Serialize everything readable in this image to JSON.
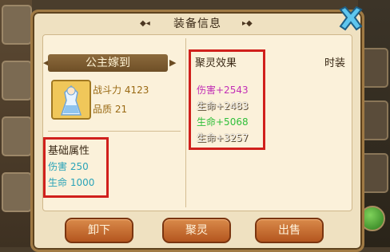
{
  "window": {
    "title": "装备信息"
  },
  "item": {
    "name": "公主嫁到",
    "combat_label": "战斗力",
    "combat_value": "4123",
    "quality_label": "品质",
    "quality_value": "21"
  },
  "base_attrs": {
    "title": "基础属性",
    "items": [
      {
        "label": "伤害",
        "value": "250"
      },
      {
        "label": "生命",
        "value": "1000"
      }
    ]
  },
  "spirit": {
    "title": "聚灵效果",
    "items": [
      {
        "text": "伤害+2543",
        "color": "#c22fb6"
      },
      {
        "text": "生命+2483",
        "color": "#ffffff"
      },
      {
        "text": "生命+5068",
        "color": "#2fbf3a"
      },
      {
        "text": "生命+3257",
        "color": "#ffffff"
      }
    ]
  },
  "fashion": {
    "title": "时装"
  },
  "buttons": {
    "unequip": "卸下",
    "spirit": "聚灵",
    "sell": "出售"
  },
  "icons": {
    "close": "close-x-icon",
    "portrait": "princess-portrait-icon"
  }
}
